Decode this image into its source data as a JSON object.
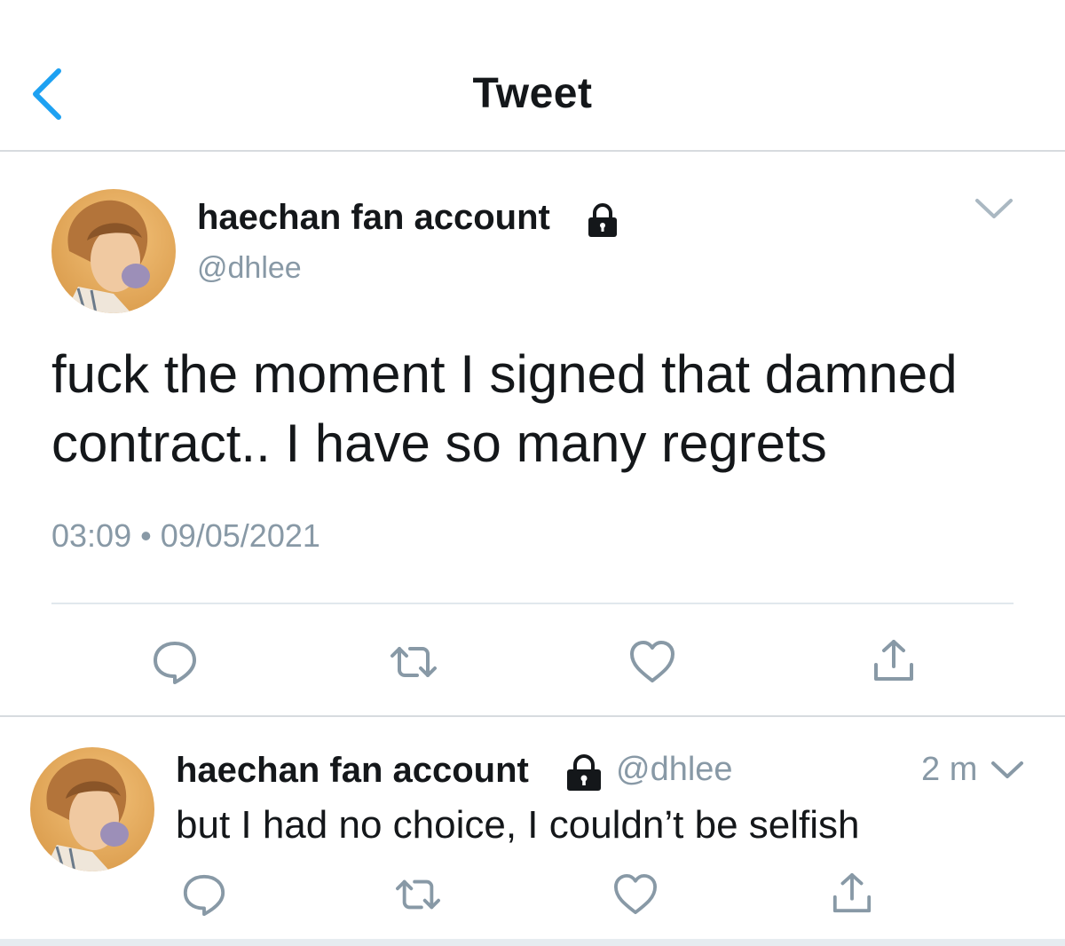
{
  "header": {
    "title": "Tweet"
  },
  "icons": {
    "back": "chevron-left-icon",
    "lock": "lock-icon",
    "caret": "chevron-down-icon",
    "reply": "reply-icon",
    "retweet": "retweet-icon",
    "like": "heart-icon",
    "share": "share-icon"
  },
  "colors": {
    "accent": "#1da1f2",
    "text": "#14171a",
    "secondary": "#8899a6",
    "divider": "#e1e8ed"
  },
  "main_tweet": {
    "author_name": "haechan fan account",
    "author_handle": "@dhlee",
    "text": "fuck the moment I signed that damned contract.. I have so many regrets",
    "time": "03:09",
    "separator": "•",
    "date": "09/05/2021"
  },
  "reply_tweet": {
    "author_name": "haechan fan account",
    "author_handle": "@dhlee",
    "time_ago": "2 m",
    "text": "but I had no choice, I couldn’t be selfish"
  }
}
